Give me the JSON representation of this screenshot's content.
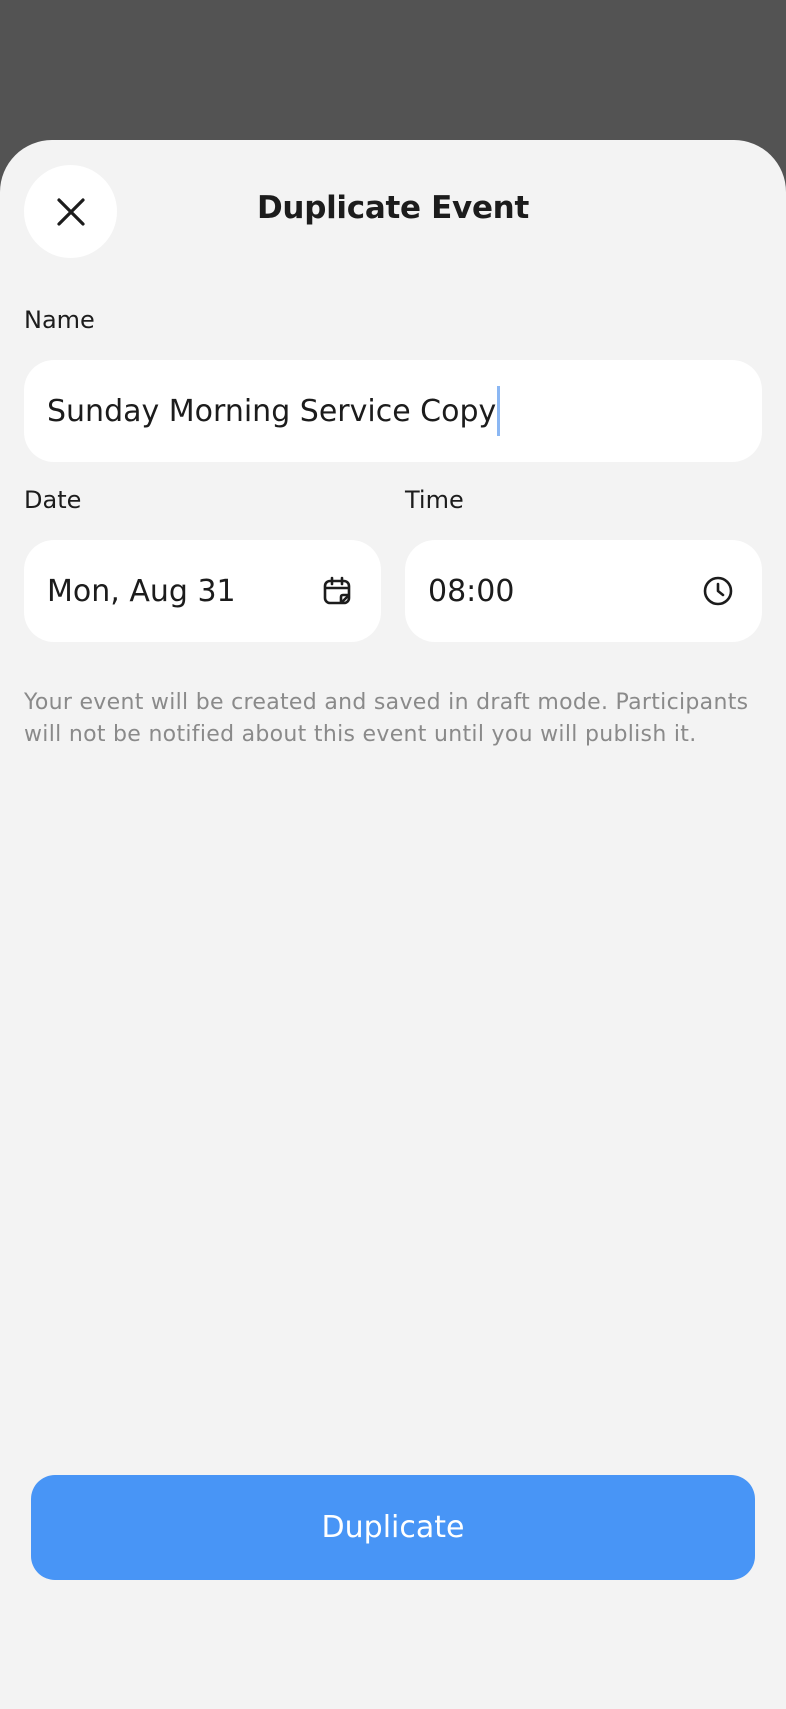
{
  "header": {
    "title": "Duplicate Event"
  },
  "form": {
    "name_label": "Name",
    "name_value": "Sunday Morning Service Copy",
    "date_label": "Date",
    "date_value": "Mon, Aug 31",
    "time_label": "Time",
    "time_value": "08:00"
  },
  "hint_text": "Your event will be created and saved in draft mode. Participants will not be notified about this event until you will publish it.",
  "actions": {
    "primary_label": "Duplicate"
  },
  "icons": {
    "close": "close-icon",
    "date": "calendar-icon",
    "time": "clock-icon"
  },
  "colors": {
    "accent": "#4895f6",
    "backdrop": "#535353",
    "sheet": "#f3f3f3",
    "field": "#ffffff",
    "hint_text": "#8a8a8a",
    "caret": "#8bb7f3"
  }
}
